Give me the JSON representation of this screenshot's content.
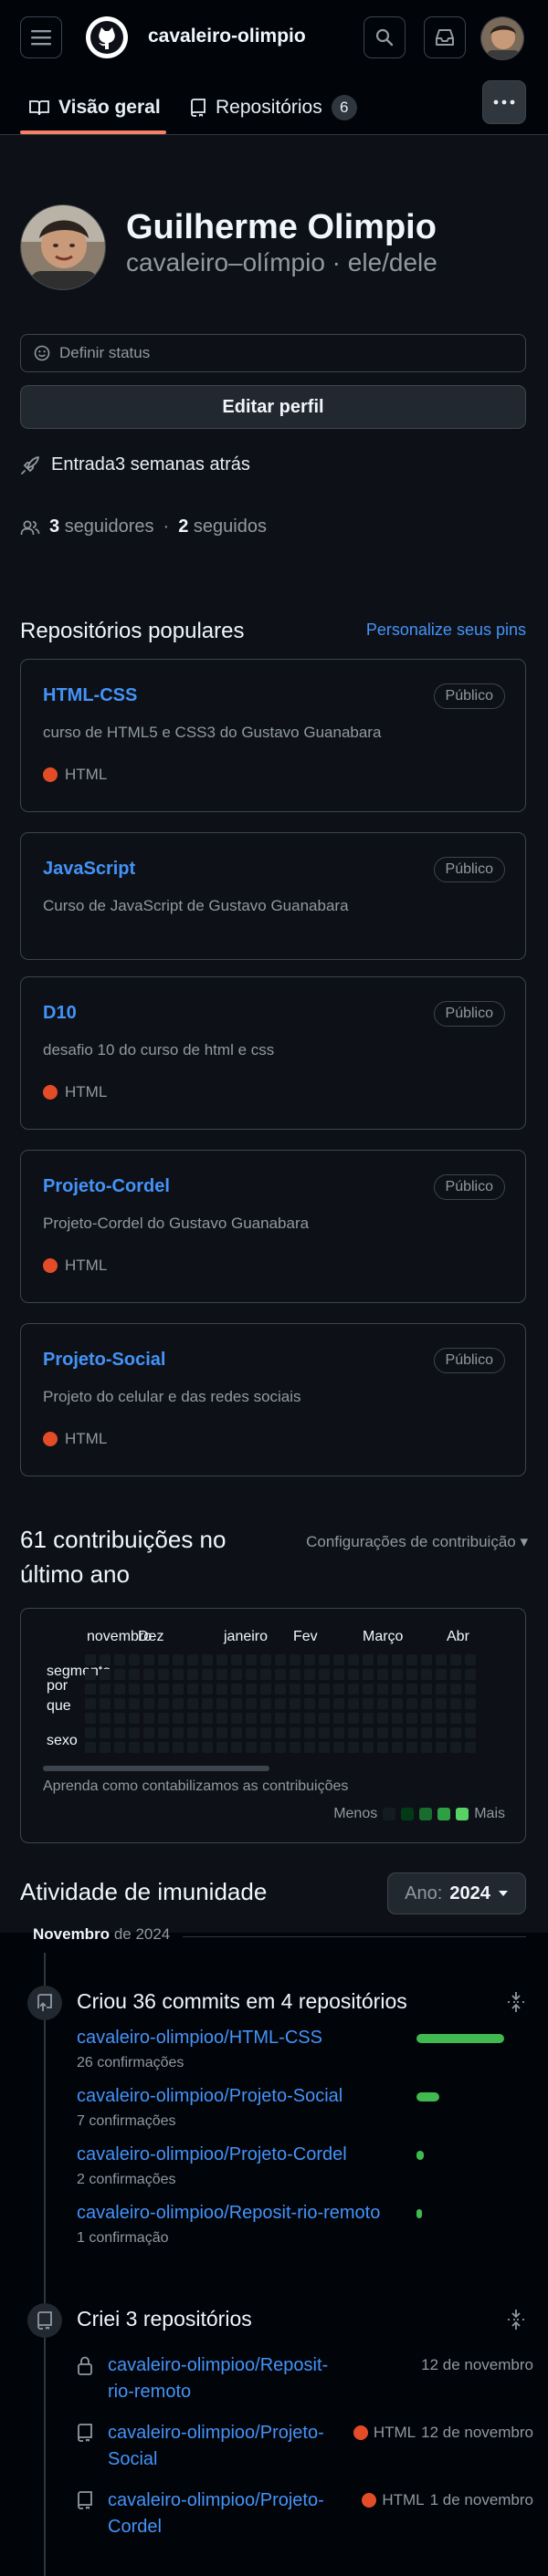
{
  "header": {
    "brand": "cavaleiro-olimpio",
    "menu_icon": "hamburger-icon",
    "logo_icon": "github-mark-icon",
    "search_icon": "search-icon",
    "inbox_icon": "inbox-icon"
  },
  "tabs": [
    {
      "label": "Visão geral",
      "icon": "book-icon",
      "selected": true
    },
    {
      "label": "Repositórios",
      "icon": "repo-icon",
      "count": "6"
    }
  ],
  "profile": {
    "name": "Guilherme Olimpio",
    "login": "cavaleiro–olímpio · ele/dele",
    "status_label": "Definir status",
    "edit_label": "Editar perfil",
    "joined": "Entrada3 semanas atrás",
    "followers_count": "3",
    "followers_label": "seguidores",
    "following_count": "2",
    "following_label": "seguidos",
    "separator": "·"
  },
  "popular": {
    "title": "Repositórios populares",
    "customize": "Personalize seus pins",
    "repos": [
      {
        "name": "HTML-CSS",
        "badge": "Público",
        "desc": "curso de HTML5 e CSS3 do Gustavo Guanabara",
        "lang": "HTML"
      },
      {
        "name": "JavaScript",
        "badge": "Público",
        "desc": "Curso de JavaScript de Gustavo Guanabara",
        "lang": ""
      },
      {
        "name": "D10",
        "badge": "Público",
        "desc": "desafio 10 do curso de html e css",
        "lang": "HTML"
      },
      {
        "name": "Projeto-Cordel",
        "badge": "Público",
        "desc": "Projeto-Cordel do Gustavo Guanabara",
        "lang": "HTML"
      },
      {
        "name": "Projeto-Social",
        "badge": "Público",
        "desc": "Projeto do celular e das redes sociais",
        "lang": "HTML"
      }
    ]
  },
  "contrib": {
    "title": "61 contribuições no último ano",
    "settings": "Configurações de contribuição ▾",
    "months": [
      "novembro",
      "Dez",
      "janeiro",
      "Fev",
      "Março",
      "Abr"
    ],
    "days": [
      "segmento",
      "por",
      "que",
      "sexo"
    ],
    "learn": "Aprenda como contabilizamos as contribuições",
    "less": "Menos",
    "more": "Mais",
    "colors": [
      "#151b23",
      "#033a16",
      "#196c2e",
      "#2ea043",
      "#56d364"
    ]
  },
  "activity": {
    "title": "Atividade de imunidade",
    "year_label": "Ano:",
    "year": "2024",
    "month_bold": "Novembro",
    "month_rest": "de 2024",
    "commits": {
      "title": "Criou 36 commits em 4 repositórios",
      "items": [
        {
          "repo": "cavaleiro-olimpioo/HTML-CSS",
          "count": "26 confirmações",
          "share": 0.72
        },
        {
          "repo": "cavaleiro-olimpioo/Projeto-Social",
          "count": "7 confirmações",
          "share": 0.19
        },
        {
          "repo": "cavaleiro-olimpioo/Projeto-Cordel",
          "count": "2 confirmações",
          "share": 0.06
        },
        {
          "repo": "cavaleiro-olimpioo/Reposit-rio-remoto",
          "count": "1 confirmação",
          "share": 0.03
        }
      ]
    },
    "created": {
      "title": "Criei 3 repositórios",
      "items": [
        {
          "repo": "cavaleiro-olimpioo/Reposit-rio-remoto",
          "lang": "",
          "date": "12 de novembro",
          "icon": "lock-icon"
        },
        {
          "repo": "cavaleiro-olimpioo/Projeto-Social",
          "lang": "HTML",
          "date": "12 de novembro",
          "icon": "repo-icon"
        },
        {
          "repo": "cavaleiro-olimpioo/Projeto-Cordel",
          "lang": "HTML",
          "date": "1 de novembro",
          "icon": "repo-icon"
        }
      ]
    }
  }
}
